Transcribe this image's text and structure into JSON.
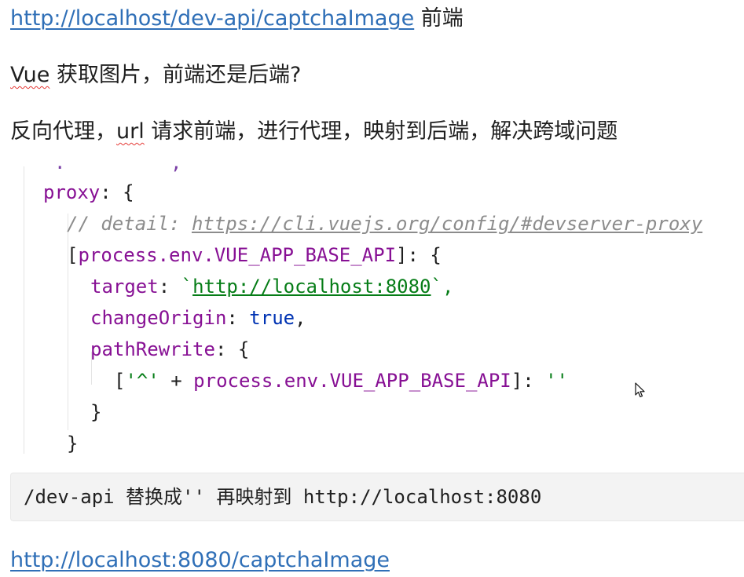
{
  "notes": {
    "line1_link": "http://localhost/dev-api/captchaImage",
    "line1_text": " 前端",
    "line2_vue": "Vue",
    "line2_text": " 获取图片，前端还是后端?",
    "line3_pre": "反向代理，",
    "line3_url": "url",
    "line3_post": " 请求前端，进行代理，映射到后端，解决跨域问题",
    "bottom_link": "http://localhost:8080/captchaImage"
  },
  "code": {
    "top_fragment": ".        ,",
    "proxy_key": "proxy",
    "colon_brace": ": {",
    "comment_prefix": "// detail: ",
    "comment_url": "https://cli.vuejs.org/config/#devserver-proxy",
    "bracket_open": "[",
    "env_expr": "process.env.VUE_APP_BASE_API",
    "bracket_close_brace": "]: {",
    "target_key": "target",
    "colon_space": ": ",
    "backtick": "`",
    "target_url": "http://localhost:8080",
    "backtick_comma": "`,",
    "change_origin_key": "changeOrigin",
    "true_value": "true",
    "comma": ",",
    "path_rewrite_key": "pathRewrite",
    "rewrite_open": "[",
    "caret_string": "'^'",
    "plus": " + ",
    "rewrite_close": "]: ",
    "empty_string": "''",
    "close_brace": "}"
  },
  "codebox": {
    "text": "/dev-api 替换成'' 再映射到 http://localhost:8080"
  },
  "icons": {
    "cursor": "mouse-pointer-icon"
  },
  "colors": {
    "link": "#2f6fb7",
    "keyword_purple": "#871094",
    "string_green": "#067d17",
    "boolean_blue": "#0033b3",
    "comment_gray": "#8c8c8c"
  }
}
